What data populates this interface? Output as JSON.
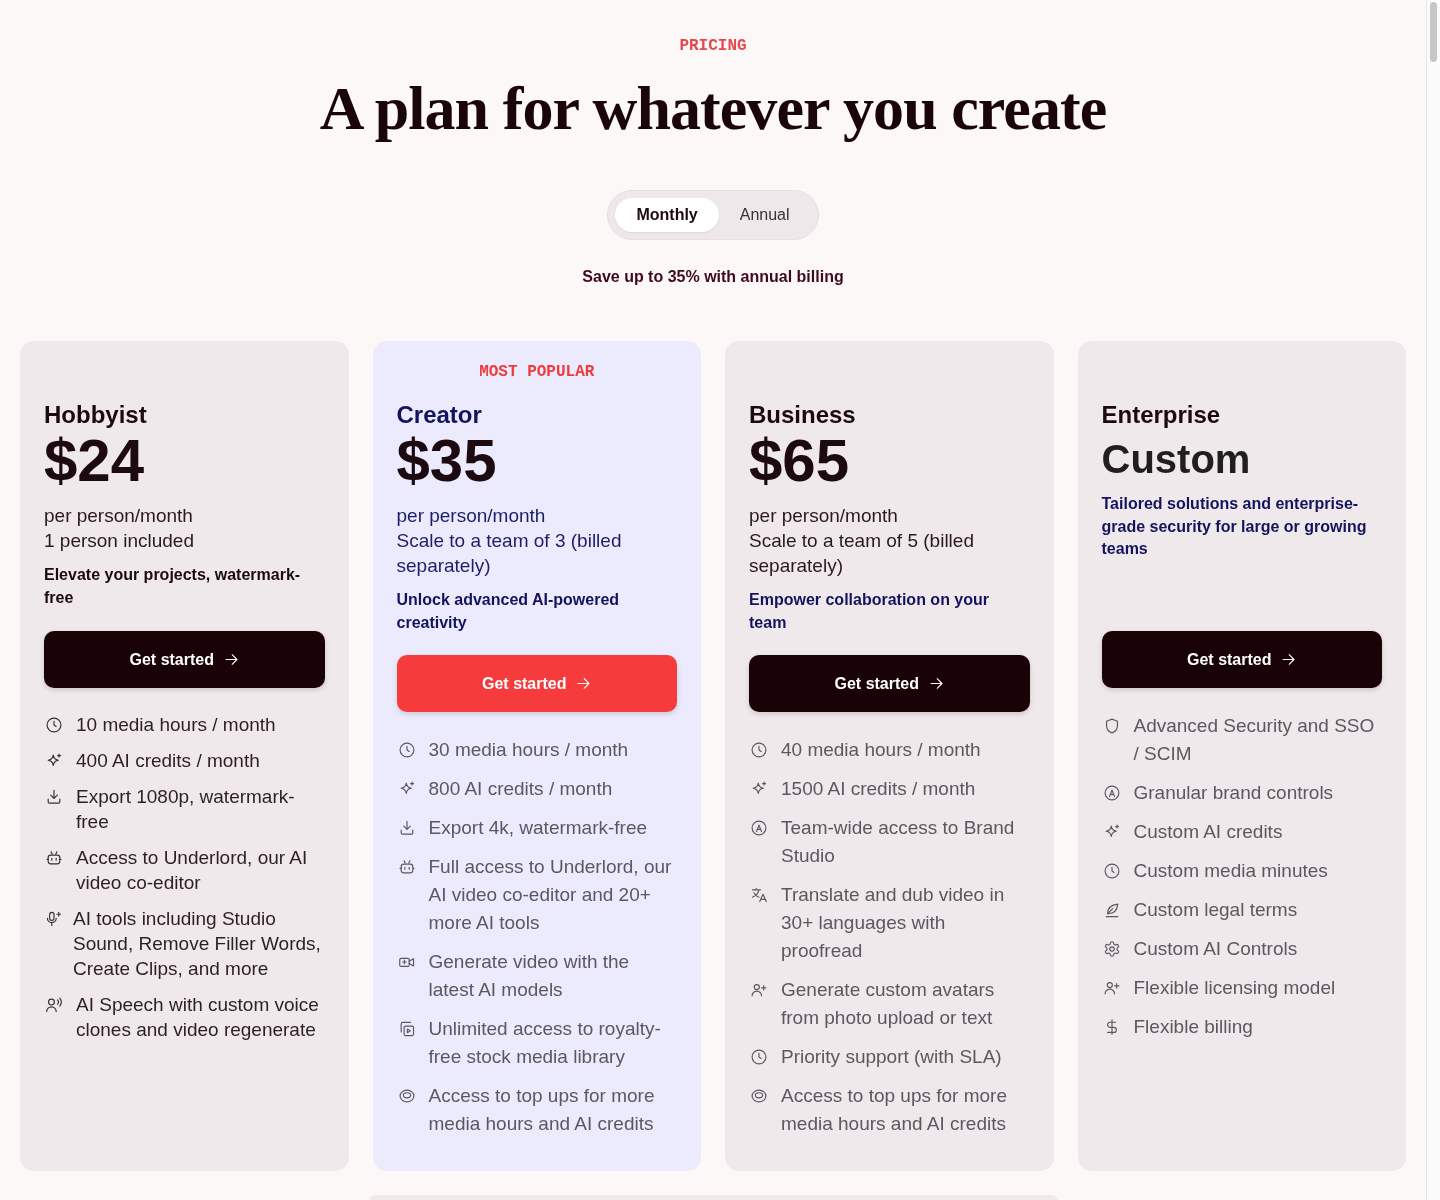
{
  "eyebrow": "PRICING",
  "title": "A plan for whatever you create",
  "billing_tabs": [
    {
      "label": "Monthly",
      "selected": true
    },
    {
      "label": "Annual",
      "selected": false
    }
  ],
  "savings_note": "Save up to 35% with annual billing",
  "plans": [
    {
      "kind": "basic",
      "name": "Hobbyist",
      "price": "$24",
      "details": [
        "per person/month",
        "1 person included"
      ],
      "tagline": "Elevate your projects, watermark-free",
      "button": "Get started",
      "features": [
        {
          "kind": "clock",
          "text": "10 media hours / month"
        },
        {
          "kind": "sparkle",
          "text": "400 AI credits / month"
        },
        {
          "kind": "download",
          "text": "Export 1080p, watermark-free"
        },
        {
          "kind": "robot",
          "text": "Access to Underlord, our AI video co-editor"
        },
        {
          "kind": "mic",
          "text": "AI tools including Studio Sound, Remove Filler Words, Create Clips, and more"
        },
        {
          "kind": "speech",
          "text": "AI Speech with custom voice clones and video regenerate"
        }
      ]
    },
    {
      "kind": "featured",
      "badge": "MOST POPULAR",
      "name": "Creator",
      "price": "$35",
      "details": [
        "per person/month",
        "Scale to a team of 3 (billed separately)"
      ],
      "tagline": "Unlock advanced AI-powered creativity",
      "button": "Get started",
      "features": [
        {
          "kind": "clock",
          "text": "30 media hours / month"
        },
        {
          "kind": "sparkle",
          "text": "800 AI credits / month"
        },
        {
          "kind": "download",
          "text": "Export 4k, watermark-free"
        },
        {
          "kind": "robot",
          "text": "Full access to Underlord, our AI video co-editor and 20+ more AI tools"
        },
        {
          "kind": "video",
          "text": "Generate video with the latest AI models"
        },
        {
          "kind": "library",
          "text": "Unlimited access to royalty-free stock media library"
        },
        {
          "kind": "coin",
          "text": "Access to top ups for more media hours and AI credits"
        }
      ]
    },
    {
      "kind": "standard",
      "name": "Business",
      "price": "$65",
      "details": [
        "per person/month",
        "Scale to a team of 5 (billed separately)"
      ],
      "tagline": "Empower collaboration on your team",
      "button": "Get started",
      "features": [
        {
          "kind": "clock",
          "text": "40 media hours / month"
        },
        {
          "kind": "sparkle",
          "text": "1500 AI credits / month"
        },
        {
          "kind": "brand",
          "text": "Team-wide access to Brand Studio"
        },
        {
          "kind": "translate",
          "text": "Translate and dub video in 30+ languages with proofread"
        },
        {
          "kind": "avatar",
          "text": "Generate custom avatars from photo upload or text"
        },
        {
          "kind": "clock",
          "text": "Priority support (with SLA)"
        },
        {
          "kind": "coin",
          "text": "Access to top ups for more media hours and AI credits"
        }
      ]
    },
    {
      "kind": "enterprise",
      "name": "Enterprise",
      "price": "Custom",
      "tagline": "Tailored solutions and enterprise-grade security for large or growing teams",
      "button": "Get started",
      "features": [
        {
          "kind": "shield",
          "text": "Advanced Security and SSO / SCIM"
        },
        {
          "kind": "brand",
          "text": "Granular brand controls"
        },
        {
          "kind": "sparkle",
          "text": "Custom AI credits"
        },
        {
          "kind": "clock",
          "text": "Custom media minutes"
        },
        {
          "kind": "quill",
          "text": "Custom legal terms"
        },
        {
          "kind": "gear",
          "text": "Custom AI Controls"
        },
        {
          "kind": "avatar",
          "text": "Flexible licensing model"
        },
        {
          "kind": "dollar",
          "text": "Flexible billing"
        }
      ]
    }
  ]
}
